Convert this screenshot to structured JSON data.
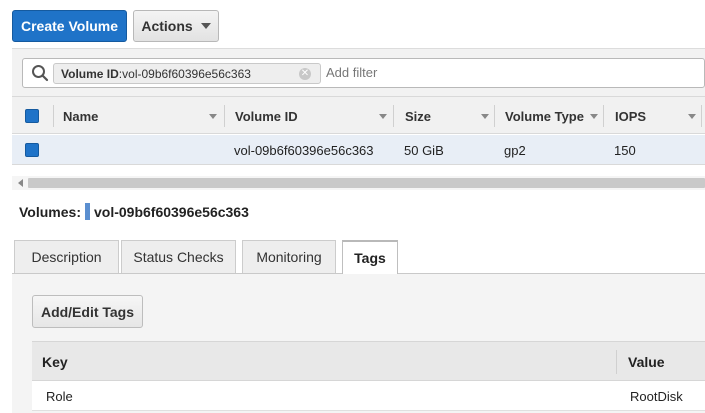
{
  "toolbar": {
    "create_label": "Create Volume",
    "actions_label": "Actions"
  },
  "filter": {
    "chip_key": "Volume ID",
    "chip_sep": " : ",
    "chip_value": "vol-09b6f60396e56c363",
    "placeholder": "Add filter"
  },
  "table": {
    "columns": [
      "Name",
      "Volume ID",
      "Size",
      "Volume Type",
      "IOPS"
    ],
    "rows": [
      {
        "name": "",
        "volume_id": "vol-09b6f60396e56c363",
        "size": "50 GiB",
        "volume_type": "gp2",
        "iops": "150",
        "selected": true
      }
    ]
  },
  "details": {
    "label": "Volumes:",
    "selected_id": "vol-09b6f60396e56c363",
    "tabs": [
      "Description",
      "Status Checks",
      "Monitoring",
      "Tags"
    ],
    "active_tab": "Tags"
  },
  "tags": {
    "edit_label": "Add/Edit Tags",
    "columns": [
      "Key",
      "Value"
    ],
    "rows": [
      {
        "key": "Role",
        "value": "RootDisk"
      }
    ]
  },
  "colors": {
    "primary": "#1f73c8",
    "selected_row": "#e8eef6"
  }
}
